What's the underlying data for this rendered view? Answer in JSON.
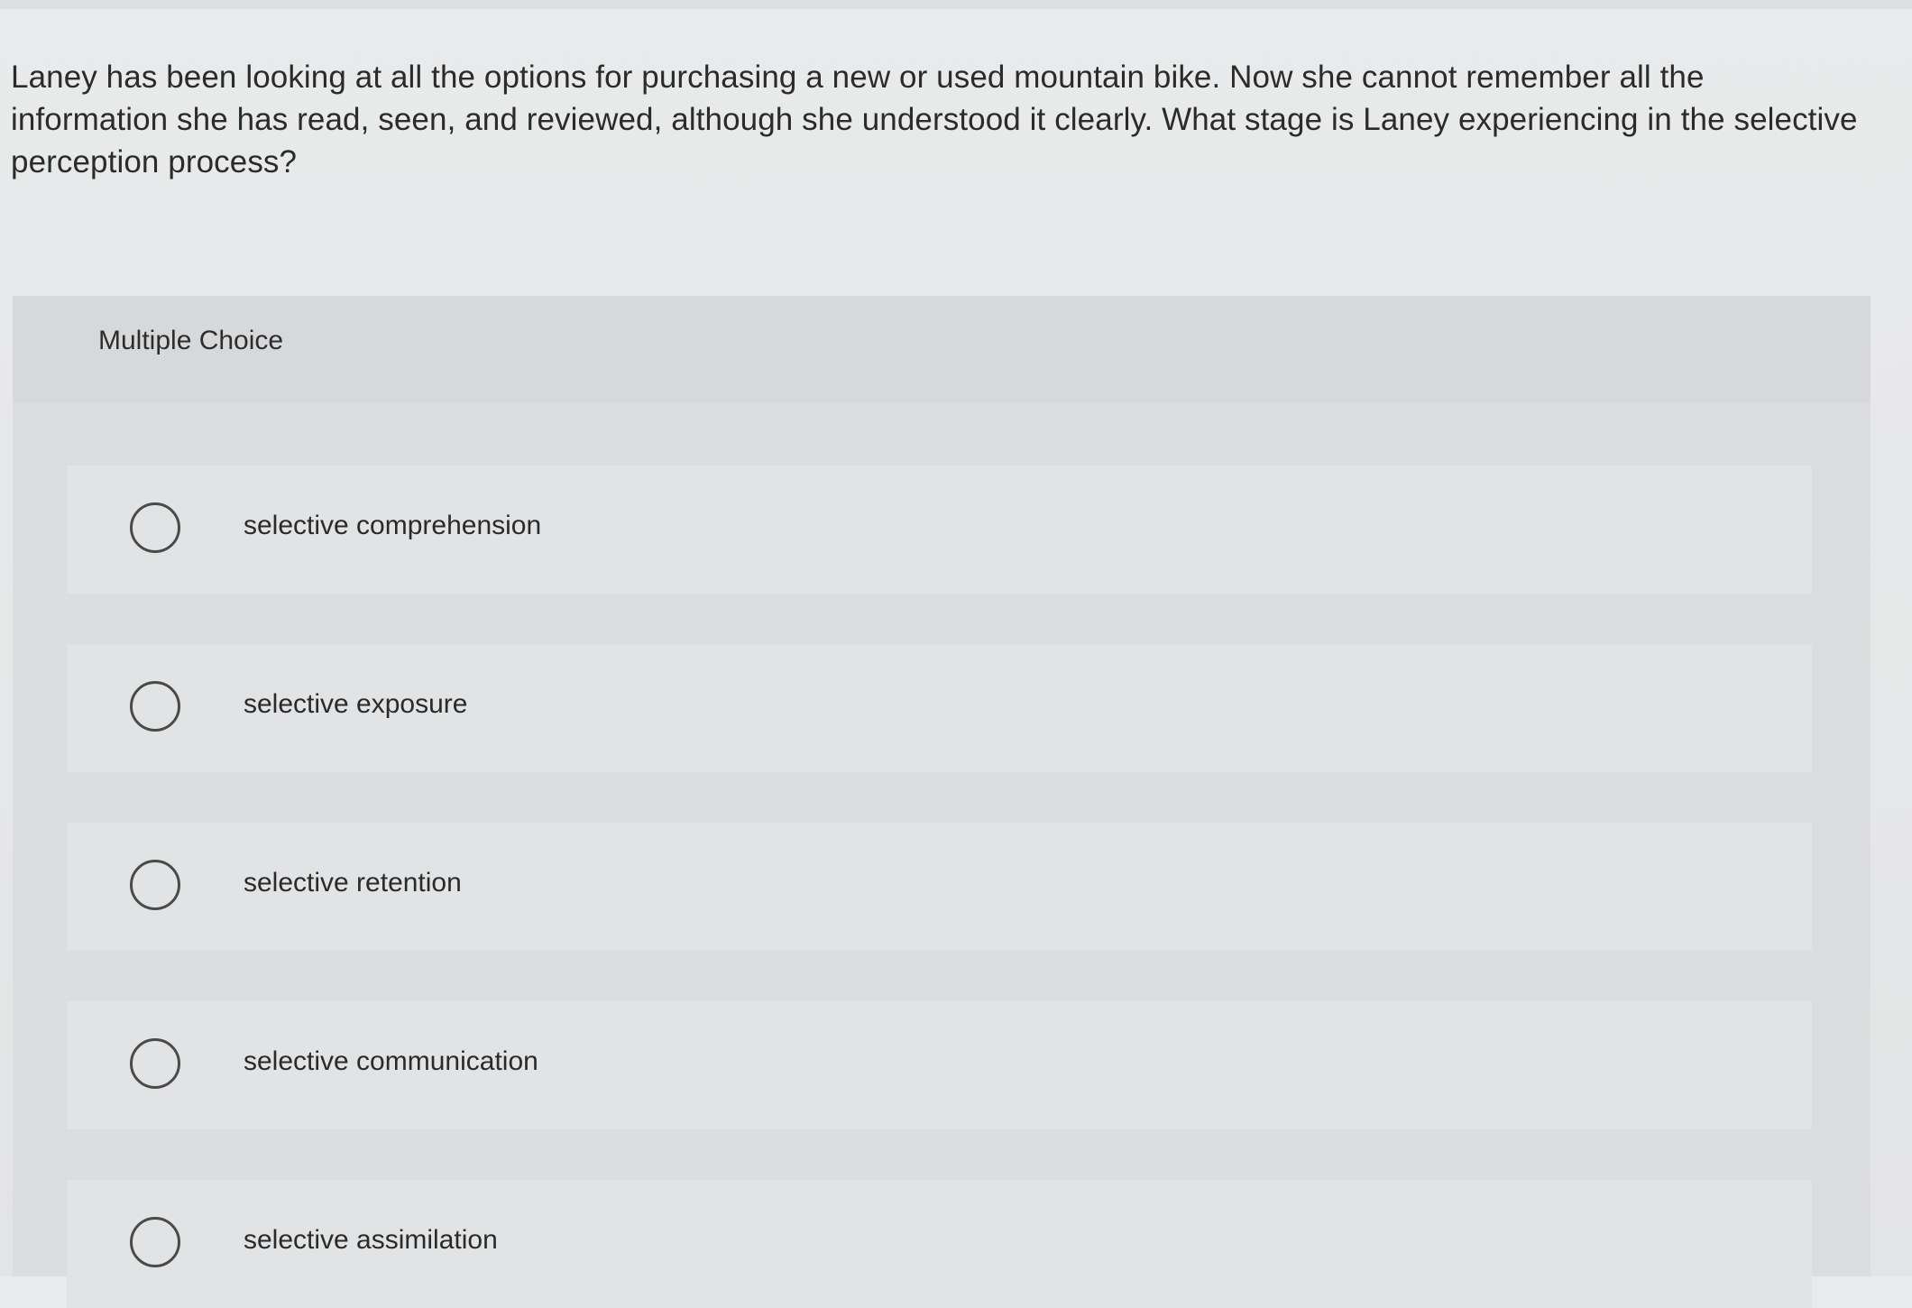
{
  "question": {
    "text": "Laney has been looking at all the options for purchasing a new or used mountain bike. Now she cannot remember all the information she has read, seen, and reviewed, although she understood it clearly. What stage is Laney experiencing in the selective perception process?"
  },
  "multiple_choice": {
    "label": "Multiple Choice",
    "options": [
      {
        "label": "selective comprehension"
      },
      {
        "label": "selective exposure"
      },
      {
        "label": "selective retention"
      },
      {
        "label": "selective communication"
      },
      {
        "label": "selective assimilation"
      }
    ]
  },
  "colors": {
    "background": "#e8e9ea",
    "panel": "#dcdddf",
    "option_row": "#e2e3e4",
    "text": "#2a2a2a",
    "radio_border": "#4a4a4a"
  }
}
